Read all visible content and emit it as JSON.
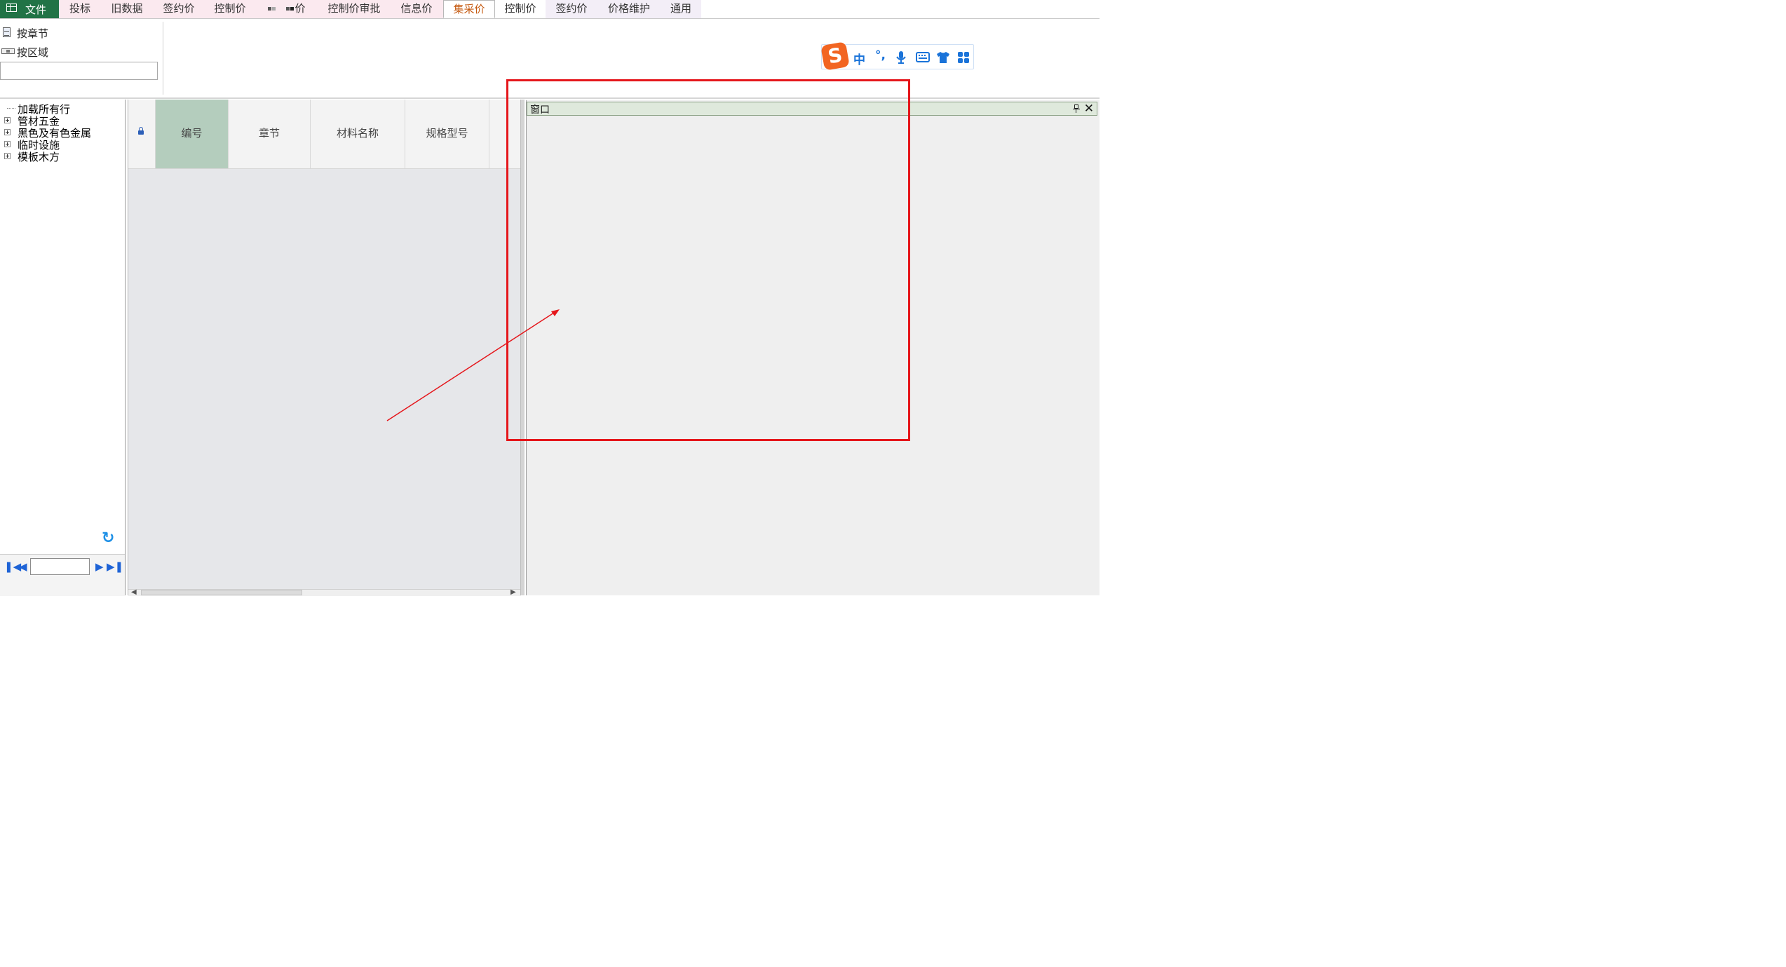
{
  "menu": {
    "file_label": "文件",
    "tabs": [
      {
        "label": "投标"
      },
      {
        "label": "旧数据"
      },
      {
        "label": "签约价"
      },
      {
        "label": "控制价"
      },
      {
        "label": "价"
      },
      {
        "label": "控制价审批"
      },
      {
        "label": "信息价"
      },
      {
        "label": "集采价"
      },
      {
        "label": "控制价"
      },
      {
        "label": "签约价"
      },
      {
        "label": "价格维护"
      },
      {
        "label": "通用"
      }
    ],
    "active_tab": "集采价"
  },
  "ribbon": {
    "by_chapter": "按章节",
    "by_region": "按区域",
    "search_value": ""
  },
  "ime": {
    "logo": "S",
    "mode": "中",
    "punct": "°,",
    "icons": [
      "mic-icon",
      "keyboard-icon",
      "skin-icon",
      "toolbox-icon"
    ]
  },
  "tree": {
    "items": [
      {
        "label": "加载所有行",
        "expandable": false
      },
      {
        "label": "管材五金",
        "expandable": true
      },
      {
        "label": "黑色及有色金属",
        "expandable": true
      },
      {
        "label": "临时设施",
        "expandable": true
      },
      {
        "label": "模板木方",
        "expandable": true
      }
    ],
    "page_value": ""
  },
  "grid": {
    "columns": [
      "编号",
      "章节",
      "材料名称",
      "规格型号"
    ],
    "selected_column": "编号"
  },
  "dock_window": {
    "title": "窗口"
  },
  "colors": {
    "file_tab": "#217346",
    "active_tab_text": "#c55a11",
    "selected_column": "#b4cdbd",
    "annotation_red": "#e5161b",
    "ime_blue": "#1a73d9",
    "ime_logo": "#f26522"
  }
}
